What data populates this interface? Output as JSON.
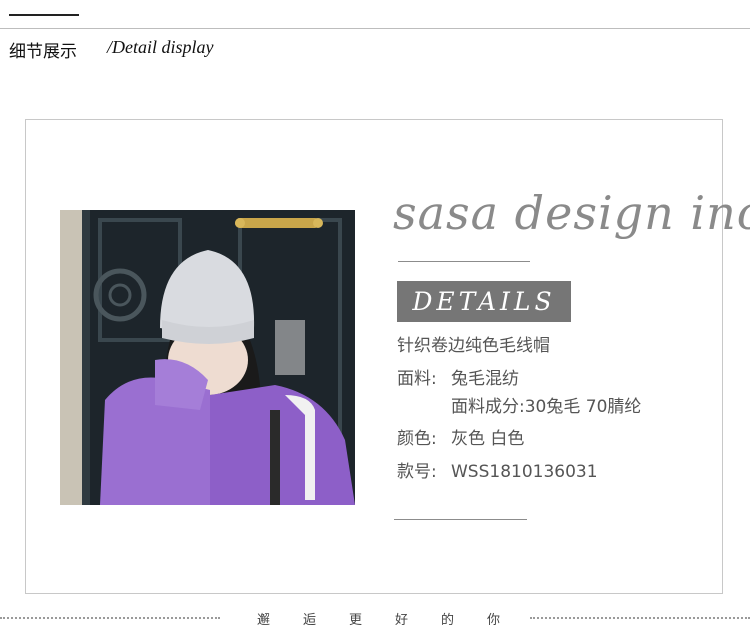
{
  "header": {
    "title": "细节展示",
    "subtitle": "/Detail display"
  },
  "brand": {
    "name": "sasa design inc",
    "badge": "DETAILS"
  },
  "product": {
    "name": "针织卷边纯色毛线帽",
    "fabric_label": "面料:",
    "fabric_value": "兔毛混纺",
    "composition_label": "面料成分:",
    "composition_value": "30兔毛 70腈纶",
    "color_label": "颜色:",
    "color_value": "灰色 白色",
    "sku_label": "款号:",
    "sku_value": "WSS1810136031"
  },
  "footer": {
    "slogan": [
      "邂",
      "逅",
      "更",
      "好",
      "的",
      "你"
    ]
  },
  "colors": {
    "badge_bg": "#767676",
    "brand_text": "#8a8a8a",
    "jacket": "#9a6fd1"
  }
}
